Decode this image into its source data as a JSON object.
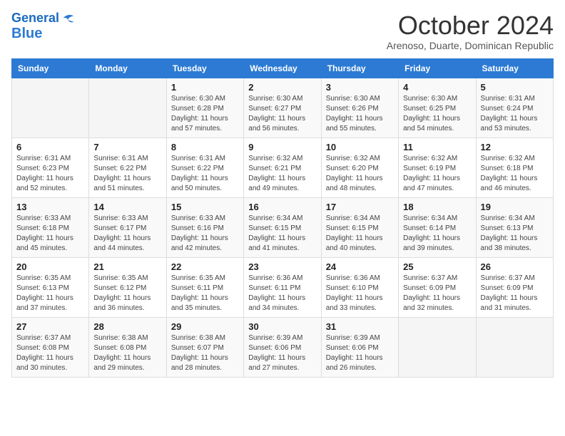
{
  "header": {
    "logo_line1": "General",
    "logo_line2": "Blue",
    "month": "October 2024",
    "location": "Arenoso, Duarte, Dominican Republic"
  },
  "days_of_week": [
    "Sunday",
    "Monday",
    "Tuesday",
    "Wednesday",
    "Thursday",
    "Friday",
    "Saturday"
  ],
  "weeks": [
    [
      {
        "day": "",
        "sunrise": "",
        "sunset": "",
        "daylight": ""
      },
      {
        "day": "",
        "sunrise": "",
        "sunset": "",
        "daylight": ""
      },
      {
        "day": "1",
        "sunrise": "Sunrise: 6:30 AM",
        "sunset": "Sunset: 6:28 PM",
        "daylight": "Daylight: 11 hours and 57 minutes."
      },
      {
        "day": "2",
        "sunrise": "Sunrise: 6:30 AM",
        "sunset": "Sunset: 6:27 PM",
        "daylight": "Daylight: 11 hours and 56 minutes."
      },
      {
        "day": "3",
        "sunrise": "Sunrise: 6:30 AM",
        "sunset": "Sunset: 6:26 PM",
        "daylight": "Daylight: 11 hours and 55 minutes."
      },
      {
        "day": "4",
        "sunrise": "Sunrise: 6:30 AM",
        "sunset": "Sunset: 6:25 PM",
        "daylight": "Daylight: 11 hours and 54 minutes."
      },
      {
        "day": "5",
        "sunrise": "Sunrise: 6:31 AM",
        "sunset": "Sunset: 6:24 PM",
        "daylight": "Daylight: 11 hours and 53 minutes."
      }
    ],
    [
      {
        "day": "6",
        "sunrise": "Sunrise: 6:31 AM",
        "sunset": "Sunset: 6:23 PM",
        "daylight": "Daylight: 11 hours and 52 minutes."
      },
      {
        "day": "7",
        "sunrise": "Sunrise: 6:31 AM",
        "sunset": "Sunset: 6:22 PM",
        "daylight": "Daylight: 11 hours and 51 minutes."
      },
      {
        "day": "8",
        "sunrise": "Sunrise: 6:31 AM",
        "sunset": "Sunset: 6:22 PM",
        "daylight": "Daylight: 11 hours and 50 minutes."
      },
      {
        "day": "9",
        "sunrise": "Sunrise: 6:32 AM",
        "sunset": "Sunset: 6:21 PM",
        "daylight": "Daylight: 11 hours and 49 minutes."
      },
      {
        "day": "10",
        "sunrise": "Sunrise: 6:32 AM",
        "sunset": "Sunset: 6:20 PM",
        "daylight": "Daylight: 11 hours and 48 minutes."
      },
      {
        "day": "11",
        "sunrise": "Sunrise: 6:32 AM",
        "sunset": "Sunset: 6:19 PM",
        "daylight": "Daylight: 11 hours and 47 minutes."
      },
      {
        "day": "12",
        "sunrise": "Sunrise: 6:32 AM",
        "sunset": "Sunset: 6:18 PM",
        "daylight": "Daylight: 11 hours and 46 minutes."
      }
    ],
    [
      {
        "day": "13",
        "sunrise": "Sunrise: 6:33 AM",
        "sunset": "Sunset: 6:18 PM",
        "daylight": "Daylight: 11 hours and 45 minutes."
      },
      {
        "day": "14",
        "sunrise": "Sunrise: 6:33 AM",
        "sunset": "Sunset: 6:17 PM",
        "daylight": "Daylight: 11 hours and 44 minutes."
      },
      {
        "day": "15",
        "sunrise": "Sunrise: 6:33 AM",
        "sunset": "Sunset: 6:16 PM",
        "daylight": "Daylight: 11 hours and 42 minutes."
      },
      {
        "day": "16",
        "sunrise": "Sunrise: 6:34 AM",
        "sunset": "Sunset: 6:15 PM",
        "daylight": "Daylight: 11 hours and 41 minutes."
      },
      {
        "day": "17",
        "sunrise": "Sunrise: 6:34 AM",
        "sunset": "Sunset: 6:15 PM",
        "daylight": "Daylight: 11 hours and 40 minutes."
      },
      {
        "day": "18",
        "sunrise": "Sunrise: 6:34 AM",
        "sunset": "Sunset: 6:14 PM",
        "daylight": "Daylight: 11 hours and 39 minutes."
      },
      {
        "day": "19",
        "sunrise": "Sunrise: 6:34 AM",
        "sunset": "Sunset: 6:13 PM",
        "daylight": "Daylight: 11 hours and 38 minutes."
      }
    ],
    [
      {
        "day": "20",
        "sunrise": "Sunrise: 6:35 AM",
        "sunset": "Sunset: 6:13 PM",
        "daylight": "Daylight: 11 hours and 37 minutes."
      },
      {
        "day": "21",
        "sunrise": "Sunrise: 6:35 AM",
        "sunset": "Sunset: 6:12 PM",
        "daylight": "Daylight: 11 hours and 36 minutes."
      },
      {
        "day": "22",
        "sunrise": "Sunrise: 6:35 AM",
        "sunset": "Sunset: 6:11 PM",
        "daylight": "Daylight: 11 hours and 35 minutes."
      },
      {
        "day": "23",
        "sunrise": "Sunrise: 6:36 AM",
        "sunset": "Sunset: 6:11 PM",
        "daylight": "Daylight: 11 hours and 34 minutes."
      },
      {
        "day": "24",
        "sunrise": "Sunrise: 6:36 AM",
        "sunset": "Sunset: 6:10 PM",
        "daylight": "Daylight: 11 hours and 33 minutes."
      },
      {
        "day": "25",
        "sunrise": "Sunrise: 6:37 AM",
        "sunset": "Sunset: 6:09 PM",
        "daylight": "Daylight: 11 hours and 32 minutes."
      },
      {
        "day": "26",
        "sunrise": "Sunrise: 6:37 AM",
        "sunset": "Sunset: 6:09 PM",
        "daylight": "Daylight: 11 hours and 31 minutes."
      }
    ],
    [
      {
        "day": "27",
        "sunrise": "Sunrise: 6:37 AM",
        "sunset": "Sunset: 6:08 PM",
        "daylight": "Daylight: 11 hours and 30 minutes."
      },
      {
        "day": "28",
        "sunrise": "Sunrise: 6:38 AM",
        "sunset": "Sunset: 6:08 PM",
        "daylight": "Daylight: 11 hours and 29 minutes."
      },
      {
        "day": "29",
        "sunrise": "Sunrise: 6:38 AM",
        "sunset": "Sunset: 6:07 PM",
        "daylight": "Daylight: 11 hours and 28 minutes."
      },
      {
        "day": "30",
        "sunrise": "Sunrise: 6:39 AM",
        "sunset": "Sunset: 6:06 PM",
        "daylight": "Daylight: 11 hours and 27 minutes."
      },
      {
        "day": "31",
        "sunrise": "Sunrise: 6:39 AM",
        "sunset": "Sunset: 6:06 PM",
        "daylight": "Daylight: 11 hours and 26 minutes."
      },
      {
        "day": "",
        "sunrise": "",
        "sunset": "",
        "daylight": ""
      },
      {
        "day": "",
        "sunrise": "",
        "sunset": "",
        "daylight": ""
      }
    ]
  ]
}
